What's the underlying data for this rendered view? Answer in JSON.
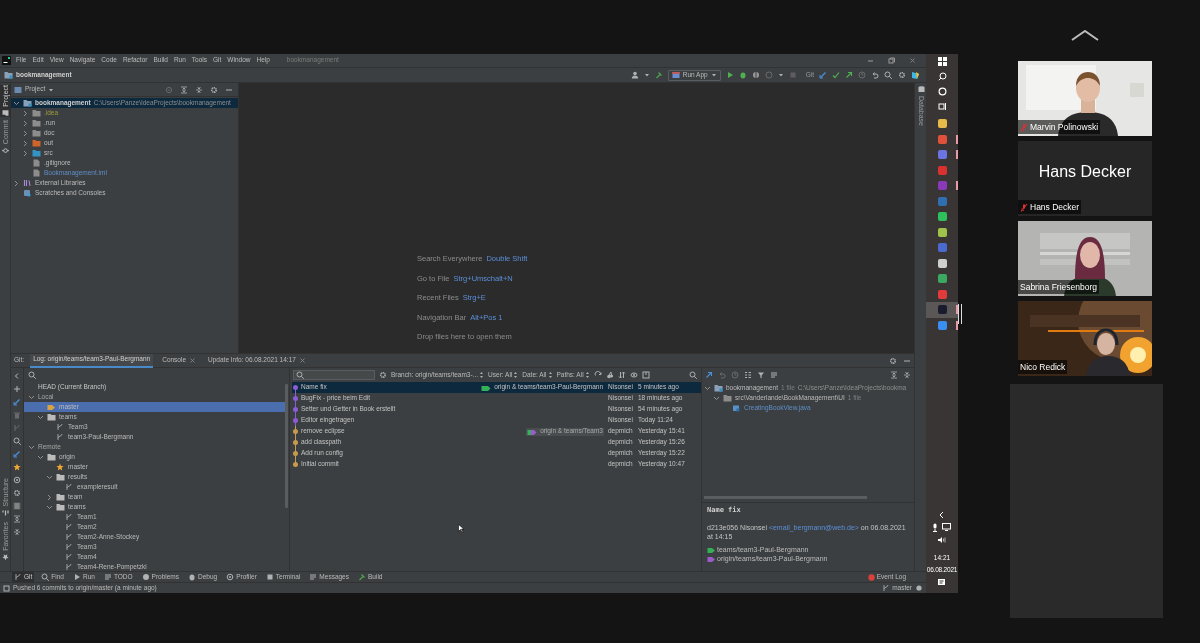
{
  "ide": {
    "menu": [
      "File",
      "Edit",
      "View",
      "Navigate",
      "Code",
      "Refactor",
      "Build",
      "Run",
      "Tools",
      "Git",
      "Window",
      "Help"
    ],
    "window_title": "bookmanagement",
    "breadcrumb": "bookmanagement",
    "run_config": "Run App",
    "vcs_label": "Git",
    "left_tabs": [
      {
        "label": "Project",
        "selected": true
      },
      {
        "label": "Commit",
        "selected": false
      }
    ],
    "bottom_left_tabs": [
      {
        "label": "Structure",
        "selected": false
      },
      {
        "label": "Favorites",
        "selected": false
      }
    ],
    "right_tabs": [
      {
        "label": "Database",
        "selected": false
      }
    ],
    "project_panel": {
      "title": "Project",
      "tree": [
        {
          "label": "bookmanagement",
          "path": "C:\\Users\\Panze\\IdeaProjects\\bookmanagement",
          "kind": "module",
          "expanded": true,
          "selected": true,
          "children": [
            {
              "label": ".idea",
              "kind": "ignored",
              "expanded": false,
              "selected": false
            },
            {
              "label": ".run",
              "kind": "folder",
              "expanded": false,
              "selected": false
            },
            {
              "label": "doc",
              "kind": "folder",
              "expanded": false,
              "selected": false
            },
            {
              "label": "out",
              "kind": "excluded",
              "expanded": false,
              "selected": false
            },
            {
              "label": "src",
              "kind": "source",
              "expanded": false,
              "selected": false
            },
            {
              "label": ".gitignore",
              "kind": "file",
              "selected": false
            },
            {
              "label": "Bookmanagement.iml",
              "kind": "iml",
              "selected": false
            }
          ]
        },
        {
          "label": "External Libraries",
          "kind": "libraries",
          "expanded": false,
          "selected": false
        },
        {
          "label": "Scratches and Consoles",
          "kind": "scratches",
          "selected": false
        }
      ]
    },
    "editor_hints": [
      {
        "action": "Search Everywhere",
        "shortcut": "Double Shift"
      },
      {
        "action": "Go to File",
        "shortcut": "Strg+Umschalt+N"
      },
      {
        "action": "Recent Files",
        "shortcut": "Strg+E"
      },
      {
        "action": "Navigation Bar",
        "shortcut": "Alt+Pos 1"
      },
      {
        "action": "Drop files here to open them"
      }
    ],
    "git_title": "Git:",
    "git_tabs": [
      {
        "label": "Log: origin/teams/team3-Paul-Bergmann",
        "selected": true,
        "closable": false
      },
      {
        "label": "Console",
        "selected": false,
        "closable": true
      },
      {
        "label": "Update Info: 06.08.2021 14:17",
        "selected": false,
        "closable": true
      }
    ],
    "branches": [
      {
        "label": "HEAD (Current Branch)",
        "kind": "head",
        "selected": false
      },
      {
        "label": "Local",
        "kind": "group",
        "expanded": true,
        "selected": false,
        "children": [
          {
            "label": "master",
            "kind": "current",
            "selected": true
          },
          {
            "label": "teams",
            "kind": "folder",
            "expanded": true,
            "selected": false,
            "children": [
              {
                "label": "Team3",
                "kind": "branch",
                "selected": false
              },
              {
                "label": "team3-Paul-Bergmann",
                "kind": "branch",
                "selected": false
              }
            ]
          }
        ]
      },
      {
        "label": "Remote",
        "kind": "group",
        "expanded": true,
        "selected": false,
        "children": [
          {
            "label": "origin",
            "kind": "folder",
            "expanded": true,
            "selected": false,
            "children": [
              {
                "label": "master",
                "kind": "favorite",
                "selected": false
              },
              {
                "label": "results",
                "kind": "folder",
                "expanded": true,
                "selected": false,
                "children": [
                  {
                    "label": "exampleresult",
                    "kind": "branch",
                    "selected": false
                  }
                ]
              },
              {
                "label": "team",
                "kind": "folder",
                "expanded": false,
                "selected": false
              },
              {
                "label": "teams",
                "kind": "folder",
                "expanded": true,
                "selected": false,
                "children": [
                  {
                    "label": "Team1",
                    "kind": "branch",
                    "selected": false
                  },
                  {
                    "label": "Team2",
                    "kind": "branch",
                    "selected": false
                  },
                  {
                    "label": "Team2-Anne-Stockey",
                    "kind": "branch",
                    "selected": false
                  },
                  {
                    "label": "Team3",
                    "kind": "branch",
                    "selected": false
                  },
                  {
                    "label": "Team4",
                    "kind": "branch",
                    "selected": false
                  },
                  {
                    "label": "Team4-Rene-Pompetzki",
                    "kind": "branch",
                    "selected": false
                  }
                ]
              }
            ]
          }
        ]
      }
    ],
    "log": {
      "filters": [
        "Branch: origin/teams/team3-...",
        "User: All",
        "Date: All",
        "Paths: All"
      ],
      "commits": [
        {
          "subject": "Name fix",
          "refs": {
            "label": "origin & teams/team3-Paul-Bergmann",
            "dimmed": false
          },
          "author": "Nisonsei",
          "date": "5 minutes ago",
          "color": "#8b5cd6",
          "selected": true
        },
        {
          "subject": "BugFix - price beim Edit",
          "author": "Nisonsei",
          "date": "18 minutes ago",
          "color": "#8b5cd6",
          "selected": false
        },
        {
          "subject": "Setter und Getter in Book erstellt",
          "author": "Nisonsei",
          "date": "54 minutes ago",
          "color": "#8b5cd6",
          "selected": false
        },
        {
          "subject": "Editor eingetragen",
          "author": "Nisonsei",
          "date": "Today 11:24",
          "color": "#8b5cd6",
          "selected": false
        },
        {
          "subject": "remove eclipse",
          "refs": {
            "label": "origin & teams/Team3",
            "dimmed": true
          },
          "author": "depmich",
          "date": "Yesterday 15:41",
          "color": "#c89b4c",
          "selected": false
        },
        {
          "subject": "add classpath",
          "author": "depmich",
          "date": "Yesterday 15:26",
          "color": "#c89b4c",
          "selected": false
        },
        {
          "subject": "Add run config",
          "author": "depmich",
          "date": "Yesterday 15:22",
          "color": "#c89b4c",
          "selected": false
        },
        {
          "subject": "Initial commit",
          "author": "depmich",
          "date": "Yesterday 10:47",
          "color": "#c89b4c",
          "selected": false
        }
      ]
    },
    "changes": [
      {
        "label": "bookmanagement",
        "info": "1 file",
        "path": "C:\\Users\\Panze\\IdeaProjects\\bookma",
        "kind": "module",
        "expanded": true,
        "children": [
          {
            "label": "src\\Vanderlande\\BookManagement\\UI",
            "info": "1 file",
            "kind": "folder",
            "expanded": true,
            "children": [
              {
                "label": "CreatingBookView.java",
                "kind": "file"
              }
            ]
          }
        ]
      }
    ],
    "details": {
      "subject": "Name fix",
      "hash": "d213e056",
      "author": "Nisonsei",
      "email": "<email_bergmann@web.de>",
      "date": "on 06.08.2021 at 14:15",
      "branches": [
        {
          "label": "teams/team3-Paul-Bergmann",
          "kind": "local"
        },
        {
          "label": "origin/teams/team3-Paul-Bergmann",
          "kind": "remote"
        }
      ]
    },
    "tool_windows": [
      {
        "label": "Git",
        "selected": true
      },
      {
        "label": "Find",
        "selected": false
      },
      {
        "label": "Run",
        "selected": false
      },
      {
        "label": "TODO",
        "selected": false
      },
      {
        "label": "Problems",
        "selected": false
      },
      {
        "label": "Debug",
        "selected": false
      },
      {
        "label": "Profiler",
        "selected": false
      },
      {
        "label": "Terminal",
        "selected": false
      },
      {
        "label": "Messages",
        "selected": false
      },
      {
        "label": "Build",
        "selected": false
      }
    ],
    "event_log": "Event Log",
    "status": {
      "message": "Pushed 6 commits to origin/master (a minute ago)",
      "branch": "master"
    }
  },
  "taskbar": {
    "apps": [
      {
        "color": "#e8b84a",
        "selected": false,
        "running": false
      },
      {
        "color": "#e0503a",
        "selected": false,
        "running": true
      },
      {
        "color": "#6b74e0",
        "selected": false,
        "running": true
      },
      {
        "color": "#d93030",
        "selected": false,
        "running": false
      },
      {
        "color": "#8a3ab8",
        "selected": false,
        "running": true
      },
      {
        "color": "#2f6fb0",
        "selected": false,
        "running": false
      },
      {
        "color": "#2ec05a",
        "selected": false,
        "running": false
      },
      {
        "color": "#9fc24a",
        "selected": false,
        "running": false
      },
      {
        "color": "#4a6ad0",
        "selected": false,
        "running": false
      },
      {
        "color": "#cfcfcf",
        "selected": false,
        "running": false
      },
      {
        "color": "#3aa860",
        "selected": false,
        "running": false
      },
      {
        "color": "#e03a3a",
        "selected": false,
        "running": false
      },
      {
        "color": "#1b1b2e",
        "selected": true,
        "running": true
      },
      {
        "color": "#3a8ef0",
        "selected": false,
        "running": true
      }
    ],
    "time": "14:21",
    "date": "06.08.2021"
  },
  "participants": [
    {
      "name": "Marvin Polinowski",
      "muted": true,
      "kind": "video"
    },
    {
      "name": "Hans Decker",
      "display_name": "Hans Decker",
      "muted": true,
      "kind": "name"
    },
    {
      "name": "Sabrina Friesenborg",
      "muted": false,
      "kind": "video"
    },
    {
      "name": "Nico Redick",
      "muted": false,
      "kind": "video"
    }
  ]
}
